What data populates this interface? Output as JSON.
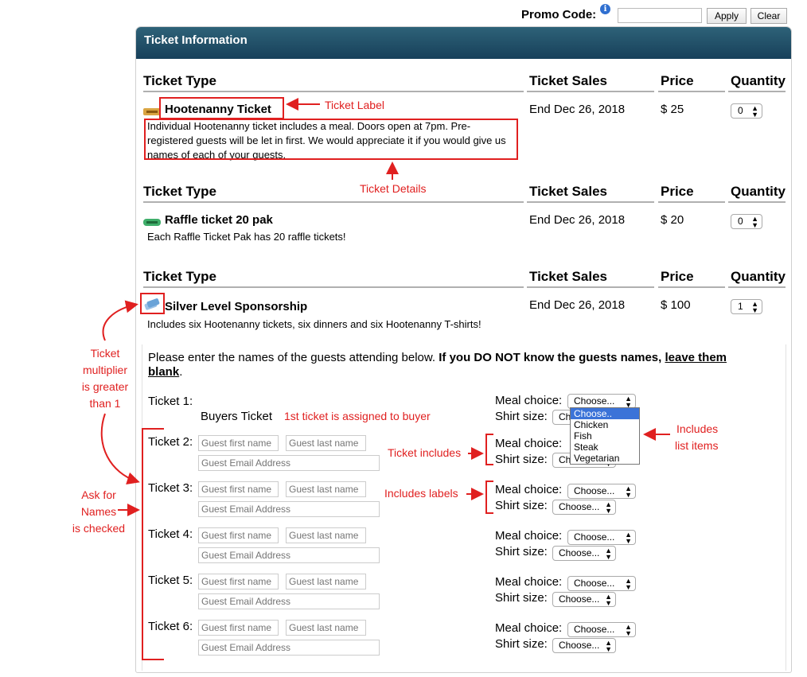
{
  "promo": {
    "label": "Promo Code:",
    "input_value": "",
    "apply_label": "Apply",
    "clear_label": "Clear"
  },
  "panel": {
    "title": "Ticket Information"
  },
  "table": {
    "col_type": "Ticket Type",
    "col_sales": "Ticket Sales",
    "col_price": "Price",
    "col_quantity": "Quantity"
  },
  "tickets": [
    {
      "name": "Hootenanny Ticket",
      "details": "Individual Hootenanny ticket includes a meal. Doors open at 7pm. Pre-registered guests will be let in first. We would appreciate it if you would give us names of each of your guests.",
      "sales": "End Dec 26, 2018",
      "price": "$ 25",
      "quantity": "0",
      "icon_color": "#d9a441"
    },
    {
      "name": "Raffle ticket 20 pak",
      "details": "Each Raffle Ticket Pak has 20 raffle tickets!",
      "sales": "End Dec 26, 2018",
      "price": "$ 20",
      "quantity": "0",
      "icon_color": "#3fae6a"
    },
    {
      "name": "Silver Level Sponsorship",
      "details": "Includes six Hootenanny tickets, six dinners and six Hootenanny T-shirts!",
      "sales": "End Dec 26, 2018",
      "price": "$ 100",
      "quantity": "1",
      "icon_color": "#6aa3d8"
    }
  ],
  "guests": {
    "intro_plain": "Please enter the names of the guests attending below.",
    "intro_bold": "If you DO NOT know the guests names,",
    "intro_bold_underline": "leave them blank",
    "intro_end": ".",
    "buyers_ticket_label": "Buyers Ticket",
    "first_name_placeholder": "Guest first name",
    "last_name_placeholder": "Guest last name",
    "email_placeholder": "Guest Email Address",
    "meal_label": "Meal choice:",
    "shirt_label": "Shirt size:",
    "meal_value": "Choose...",
    "shirt_value": "Choose...",
    "meal_options": [
      "Choose..",
      "Chicken",
      "Fish",
      "Steak",
      "Vegetarian"
    ],
    "rows": [
      {
        "label": "Ticket 1:"
      },
      {
        "label": "Ticket 2:"
      },
      {
        "label": "Ticket 3:"
      },
      {
        "label": "Ticket 4:"
      },
      {
        "label": "Ticket 5:"
      },
      {
        "label": "Ticket 6:"
      }
    ]
  },
  "annotations": {
    "ticket_label": "Ticket Label",
    "ticket_details": "Ticket Details",
    "multiplier_1": "Ticket",
    "multiplier_2": "multiplier",
    "multiplier_3": "is greater",
    "multiplier_4": "than 1",
    "first_ticket": "1st ticket is assigned to buyer",
    "ticket_includes": "Ticket includes",
    "includes_labels": "Includes labels",
    "includes_list_1": "Includes",
    "includes_list_2": "list items",
    "ask_names_1": "Ask for",
    "ask_names_2": "Names",
    "ask_names_3": "is checked"
  },
  "colors": {
    "accent_red": "#e02020",
    "header_dark": "#17405a",
    "header_light": "#2e6278",
    "highlight_blue": "#3b73d8"
  }
}
